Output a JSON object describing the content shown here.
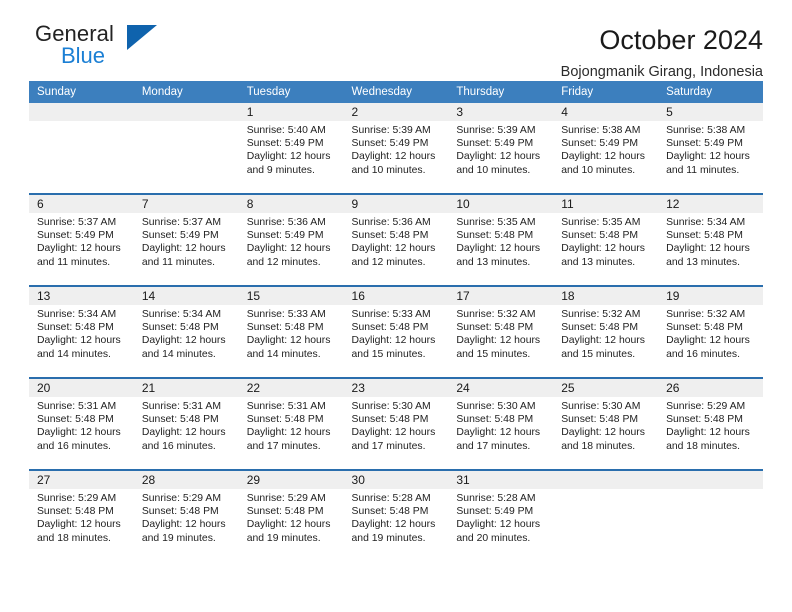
{
  "brand": {
    "name_top": "General",
    "name_bottom": "Blue",
    "triangle_color": "#0f63ad",
    "blue_text_color": "#1b7fd4"
  },
  "header": {
    "title": "October 2024",
    "subtitle": "Bojongmanik Girang, Indonesia"
  },
  "theme": {
    "header_row_bg": "#3c7fbe",
    "day_band_bg": "#efefef",
    "row_divider": "#2a6ead"
  },
  "weekday_headers": [
    "Sunday",
    "Monday",
    "Tuesday",
    "Wednesday",
    "Thursday",
    "Friday",
    "Saturday"
  ],
  "labels": {
    "sunrise_prefix": "Sunrise:",
    "sunset_prefix": "Sunset:",
    "daylight_prefix": "Daylight:"
  },
  "weeks": [
    [
      {
        "day": "",
        "sunrise": "",
        "sunset": "",
        "daylight_line1": "",
        "daylight_line2": ""
      },
      {
        "day": "",
        "sunrise": "",
        "sunset": "",
        "daylight_line1": "",
        "daylight_line2": ""
      },
      {
        "day": "1",
        "sunrise": "Sunrise: 5:40 AM",
        "sunset": "Sunset: 5:49 PM",
        "daylight_line1": "Daylight: 12 hours",
        "daylight_line2": "and 9 minutes."
      },
      {
        "day": "2",
        "sunrise": "Sunrise: 5:39 AM",
        "sunset": "Sunset: 5:49 PM",
        "daylight_line1": "Daylight: 12 hours",
        "daylight_line2": "and 10 minutes."
      },
      {
        "day": "3",
        "sunrise": "Sunrise: 5:39 AM",
        "sunset": "Sunset: 5:49 PM",
        "daylight_line1": "Daylight: 12 hours",
        "daylight_line2": "and 10 minutes."
      },
      {
        "day": "4",
        "sunrise": "Sunrise: 5:38 AM",
        "sunset": "Sunset: 5:49 PM",
        "daylight_line1": "Daylight: 12 hours",
        "daylight_line2": "and 10 minutes."
      },
      {
        "day": "5",
        "sunrise": "Sunrise: 5:38 AM",
        "sunset": "Sunset: 5:49 PM",
        "daylight_line1": "Daylight: 12 hours",
        "daylight_line2": "and 11 minutes."
      }
    ],
    [
      {
        "day": "6",
        "sunrise": "Sunrise: 5:37 AM",
        "sunset": "Sunset: 5:49 PM",
        "daylight_line1": "Daylight: 12 hours",
        "daylight_line2": "and 11 minutes."
      },
      {
        "day": "7",
        "sunrise": "Sunrise: 5:37 AM",
        "sunset": "Sunset: 5:49 PM",
        "daylight_line1": "Daylight: 12 hours",
        "daylight_line2": "and 11 minutes."
      },
      {
        "day": "8",
        "sunrise": "Sunrise: 5:36 AM",
        "sunset": "Sunset: 5:49 PM",
        "daylight_line1": "Daylight: 12 hours",
        "daylight_line2": "and 12 minutes."
      },
      {
        "day": "9",
        "sunrise": "Sunrise: 5:36 AM",
        "sunset": "Sunset: 5:48 PM",
        "daylight_line1": "Daylight: 12 hours",
        "daylight_line2": "and 12 minutes."
      },
      {
        "day": "10",
        "sunrise": "Sunrise: 5:35 AM",
        "sunset": "Sunset: 5:48 PM",
        "daylight_line1": "Daylight: 12 hours",
        "daylight_line2": "and 13 minutes."
      },
      {
        "day": "11",
        "sunrise": "Sunrise: 5:35 AM",
        "sunset": "Sunset: 5:48 PM",
        "daylight_line1": "Daylight: 12 hours",
        "daylight_line2": "and 13 minutes."
      },
      {
        "day": "12",
        "sunrise": "Sunrise: 5:34 AM",
        "sunset": "Sunset: 5:48 PM",
        "daylight_line1": "Daylight: 12 hours",
        "daylight_line2": "and 13 minutes."
      }
    ],
    [
      {
        "day": "13",
        "sunrise": "Sunrise: 5:34 AM",
        "sunset": "Sunset: 5:48 PM",
        "daylight_line1": "Daylight: 12 hours",
        "daylight_line2": "and 14 minutes."
      },
      {
        "day": "14",
        "sunrise": "Sunrise: 5:34 AM",
        "sunset": "Sunset: 5:48 PM",
        "daylight_line1": "Daylight: 12 hours",
        "daylight_line2": "and 14 minutes."
      },
      {
        "day": "15",
        "sunrise": "Sunrise: 5:33 AM",
        "sunset": "Sunset: 5:48 PM",
        "daylight_line1": "Daylight: 12 hours",
        "daylight_line2": "and 14 minutes."
      },
      {
        "day": "16",
        "sunrise": "Sunrise: 5:33 AM",
        "sunset": "Sunset: 5:48 PM",
        "daylight_line1": "Daylight: 12 hours",
        "daylight_line2": "and 15 minutes."
      },
      {
        "day": "17",
        "sunrise": "Sunrise: 5:32 AM",
        "sunset": "Sunset: 5:48 PM",
        "daylight_line1": "Daylight: 12 hours",
        "daylight_line2": "and 15 minutes."
      },
      {
        "day": "18",
        "sunrise": "Sunrise: 5:32 AM",
        "sunset": "Sunset: 5:48 PM",
        "daylight_line1": "Daylight: 12 hours",
        "daylight_line2": "and 15 minutes."
      },
      {
        "day": "19",
        "sunrise": "Sunrise: 5:32 AM",
        "sunset": "Sunset: 5:48 PM",
        "daylight_line1": "Daylight: 12 hours",
        "daylight_line2": "and 16 minutes."
      }
    ],
    [
      {
        "day": "20",
        "sunrise": "Sunrise: 5:31 AM",
        "sunset": "Sunset: 5:48 PM",
        "daylight_line1": "Daylight: 12 hours",
        "daylight_line2": "and 16 minutes."
      },
      {
        "day": "21",
        "sunrise": "Sunrise: 5:31 AM",
        "sunset": "Sunset: 5:48 PM",
        "daylight_line1": "Daylight: 12 hours",
        "daylight_line2": "and 16 minutes."
      },
      {
        "day": "22",
        "sunrise": "Sunrise: 5:31 AM",
        "sunset": "Sunset: 5:48 PM",
        "daylight_line1": "Daylight: 12 hours",
        "daylight_line2": "and 17 minutes."
      },
      {
        "day": "23",
        "sunrise": "Sunrise: 5:30 AM",
        "sunset": "Sunset: 5:48 PM",
        "daylight_line1": "Daylight: 12 hours",
        "daylight_line2": "and 17 minutes."
      },
      {
        "day": "24",
        "sunrise": "Sunrise: 5:30 AM",
        "sunset": "Sunset: 5:48 PM",
        "daylight_line1": "Daylight: 12 hours",
        "daylight_line2": "and 17 minutes."
      },
      {
        "day": "25",
        "sunrise": "Sunrise: 5:30 AM",
        "sunset": "Sunset: 5:48 PM",
        "daylight_line1": "Daylight: 12 hours",
        "daylight_line2": "and 18 minutes."
      },
      {
        "day": "26",
        "sunrise": "Sunrise: 5:29 AM",
        "sunset": "Sunset: 5:48 PM",
        "daylight_line1": "Daylight: 12 hours",
        "daylight_line2": "and 18 minutes."
      }
    ],
    [
      {
        "day": "27",
        "sunrise": "Sunrise: 5:29 AM",
        "sunset": "Sunset: 5:48 PM",
        "daylight_line1": "Daylight: 12 hours",
        "daylight_line2": "and 18 minutes."
      },
      {
        "day": "28",
        "sunrise": "Sunrise: 5:29 AM",
        "sunset": "Sunset: 5:48 PM",
        "daylight_line1": "Daylight: 12 hours",
        "daylight_line2": "and 19 minutes."
      },
      {
        "day": "29",
        "sunrise": "Sunrise: 5:29 AM",
        "sunset": "Sunset: 5:48 PM",
        "daylight_line1": "Daylight: 12 hours",
        "daylight_line2": "and 19 minutes."
      },
      {
        "day": "30",
        "sunrise": "Sunrise: 5:28 AM",
        "sunset": "Sunset: 5:48 PM",
        "daylight_line1": "Daylight: 12 hours",
        "daylight_line2": "and 19 minutes."
      },
      {
        "day": "31",
        "sunrise": "Sunrise: 5:28 AM",
        "sunset": "Sunset: 5:49 PM",
        "daylight_line1": "Daylight: 12 hours",
        "daylight_line2": "and 20 minutes."
      },
      {
        "day": "",
        "sunrise": "",
        "sunset": "",
        "daylight_line1": "",
        "daylight_line2": ""
      },
      {
        "day": "",
        "sunrise": "",
        "sunset": "",
        "daylight_line1": "",
        "daylight_line2": ""
      }
    ]
  ]
}
